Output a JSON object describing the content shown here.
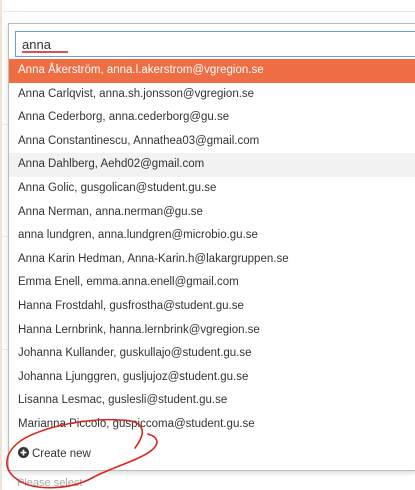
{
  "search": {
    "value": "anna"
  },
  "results": [
    "Anna Åkerström, anna.l.akerstrom@vgregion.se",
    "Anna Carlqvist, anna.sh.jonsson@vgregion.se",
    "Anna Cederborg, anna.cederborg@gu.se",
    "Anna Constantinescu, Annathea03@gmail.com",
    "Anna Dahlberg, Aehd02@gmail.com",
    "Anna Golic, gusgolican@student.gu.se",
    "Anna Nerman, anna.nerman@gu.se",
    "anna lundgren, anna.lundgren@microbio.gu.se",
    "Anna Karin Hedman, Anna-Karin.h@lakargruppen.se",
    "Emma Enell, emma.anna.enell@gmail.com",
    "Hanna Frostdahl, gusfrostha@student.gu.se",
    "Hanna Lernbrink, hanna.lernbrink@vgregion.se",
    "Johanna Kullander, guskullajo@student.gu.se",
    "Johanna Ljunggren, gusljujoz@student.gu.se",
    "Lisanna Lesmac, guslesli@student.gu.se",
    "Marianna Piccolo, guspiccoma@student.gu.se"
  ],
  "create_new": {
    "label": "Create new",
    "icon": "plus-circle-icon"
  },
  "field_below": {
    "placeholder": "Please select"
  },
  "colors": {
    "highlight": "#ee6d43",
    "hover_row": "#f2f2f2",
    "input_border": "#6b9ae0",
    "annotation": "#d9261c"
  }
}
